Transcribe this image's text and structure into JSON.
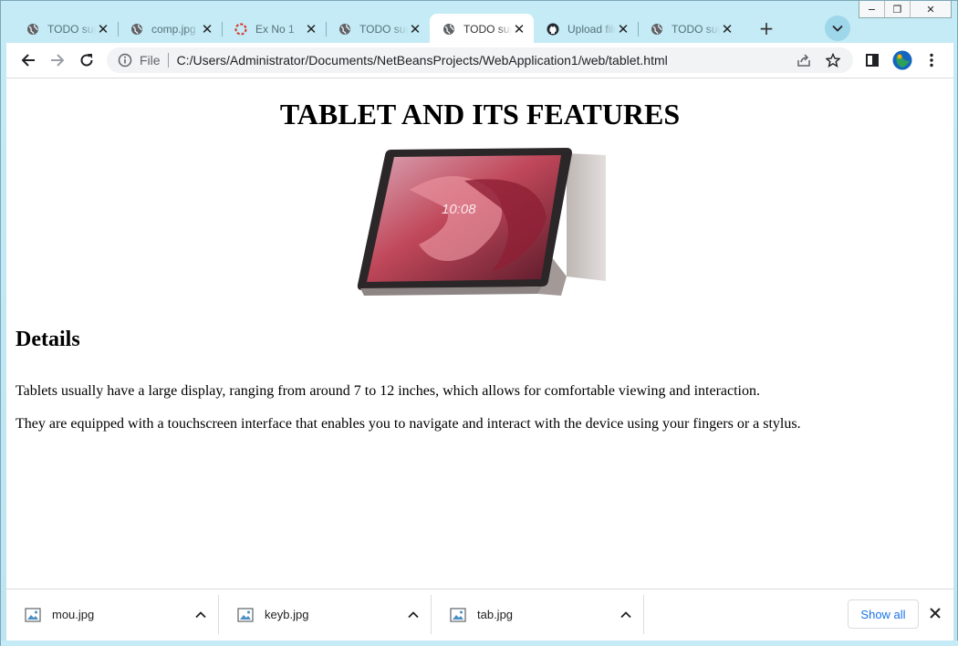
{
  "window": {
    "controls": [
      "minimize",
      "restore",
      "close"
    ]
  },
  "tabs": [
    {
      "title": "TODO supply a title",
      "icon": "globe-icon",
      "active": false
    },
    {
      "title": "comp.jpg",
      "icon": "globe-icon",
      "active": false
    },
    {
      "title": "Ex No 1",
      "icon": "loading-icon",
      "active": false
    },
    {
      "title": "TODO supply a title",
      "icon": "globe-icon",
      "active": false
    },
    {
      "title": "TODO supply a title",
      "icon": "globe-icon",
      "active": true
    },
    {
      "title": "Upload files",
      "icon": "github-icon",
      "active": false
    },
    {
      "title": "TODO supply a title",
      "icon": "globe-icon",
      "active": false
    }
  ],
  "toolbar": {
    "file_label": "File",
    "url": "C:/Users/Administrator/Documents/NetBeansProjects/WebApplication1/web/tablet.html"
  },
  "page": {
    "heading": "TABLET AND ITS FEATURES",
    "image_clock": "10:08",
    "subheading": "Details",
    "paragraph1": "Tablets usually have a large display, ranging from around 7 to 12 inches, which allows for comfortable viewing and interaction.",
    "paragraph2": "They are equipped with a touchscreen interface that enables you to navigate and interact with the device using your fingers or a stylus."
  },
  "downloads": {
    "items": [
      {
        "name": "mou.jpg"
      },
      {
        "name": "keyb.jpg"
      },
      {
        "name": "tab.jpg"
      }
    ],
    "show_all_label": "Show all"
  },
  "colors": {
    "frame": "#c4ebf6",
    "accent_link": "#1a73e8",
    "tab_search_bg": "#9fd7ea"
  }
}
